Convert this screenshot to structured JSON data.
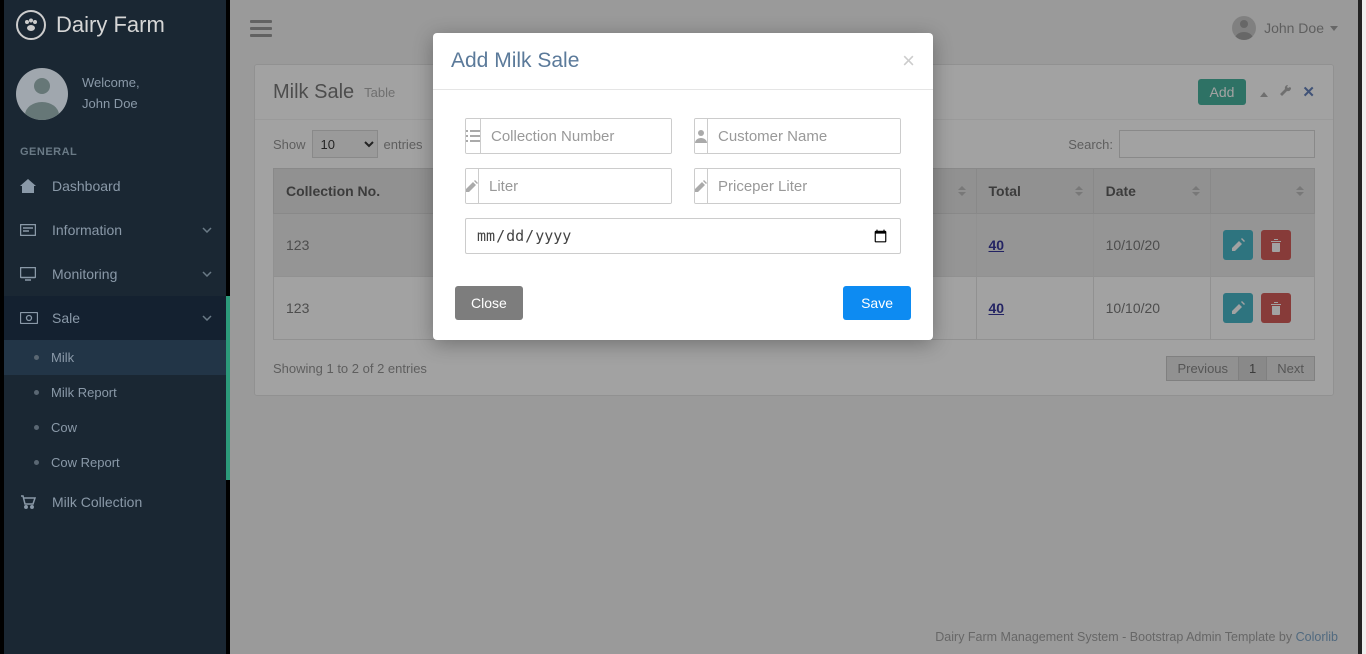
{
  "brand": "Dairy Farm",
  "welcome": "Welcome,",
  "user_name": "John Doe",
  "section_general": "GENERAL",
  "nav": {
    "dashboard": "Dashboard",
    "information": "Information",
    "monitoring": "Monitoring",
    "sale": "Sale",
    "milk_collection": "Milk Collection"
  },
  "sale_sub": {
    "milk": "Milk",
    "milk_report": "Milk Report",
    "cow": "Cow",
    "cow_report": "Cow Report"
  },
  "topbar": {
    "user": "John Doe"
  },
  "panel": {
    "title": "Milk Sale",
    "subtitle": "Table",
    "add_btn": "Add"
  },
  "length": {
    "show": "Show",
    "value": "10",
    "entries": "entries"
  },
  "search_label": "Search:",
  "headers": {
    "collection_no": "Collection No.",
    "total": "Total",
    "date": "Date"
  },
  "rows": [
    {
      "collection_no": "123",
      "total": "40",
      "date": "10/10/20"
    },
    {
      "collection_no": "123",
      "total": "40",
      "date": "10/10/20"
    }
  ],
  "info_text": "Showing 1 to 2 of 2 entries",
  "pager": {
    "prev": "Previous",
    "page": "1",
    "next": "Next"
  },
  "footer": {
    "text": "Dairy Farm Management System - Bootstrap Admin Template by ",
    "link": "Colorlib"
  },
  "modal": {
    "title": "Add Milk Sale",
    "ph_collection": "Collection Number",
    "ph_customer": "Customer Name",
    "ph_liter": "Liter",
    "ph_price": "Priceper Liter",
    "date_ph": "mm/dd/yyyy",
    "close": "Close",
    "save": "Save"
  }
}
